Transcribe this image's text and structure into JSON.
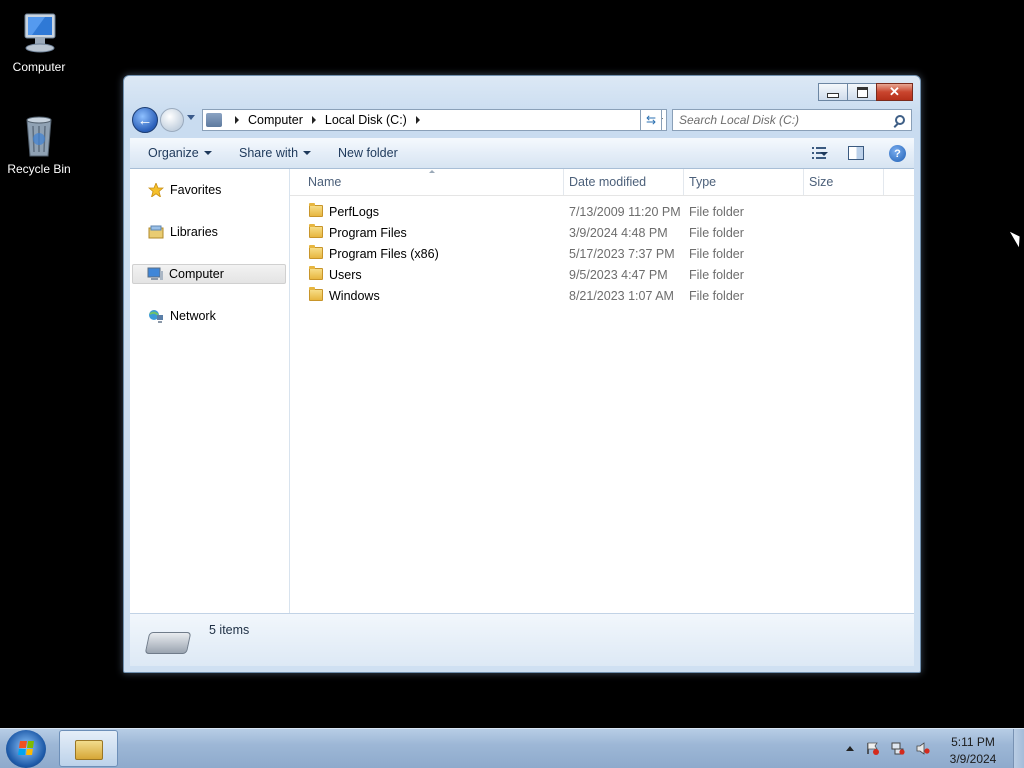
{
  "desktop": {
    "icons": [
      {
        "label": "Computer"
      },
      {
        "label": "Recycle Bin"
      }
    ]
  },
  "window": {
    "address": {
      "crumbs": [
        "Computer",
        "Local Disk (C:)"
      ]
    },
    "search": {
      "placeholder": "Search Local Disk (C:)"
    },
    "toolbar": {
      "organize": "Organize",
      "share_with": "Share with",
      "new_folder": "New folder"
    },
    "nav": {
      "items": [
        {
          "label": "Favorites",
          "selected": false
        },
        {
          "label": "Libraries",
          "selected": false
        },
        {
          "label": "Computer",
          "selected": true
        },
        {
          "label": "Network",
          "selected": false
        }
      ]
    },
    "columns": {
      "name": "Name",
      "date_modified": "Date modified",
      "type": "Type",
      "size": "Size"
    },
    "files": [
      {
        "name": "PerfLogs",
        "date": "7/13/2009 11:20 PM",
        "type": "File folder",
        "size": ""
      },
      {
        "name": "Program Files",
        "date": "3/9/2024 4:48 PM",
        "type": "File folder",
        "size": ""
      },
      {
        "name": "Program Files (x86)",
        "date": "5/17/2023 7:37 PM",
        "type": "File folder",
        "size": ""
      },
      {
        "name": "Users",
        "date": "9/5/2023 4:47 PM",
        "type": "File folder",
        "size": ""
      },
      {
        "name": "Windows",
        "date": "8/21/2023 1:07 AM",
        "type": "File folder",
        "size": ""
      }
    ],
    "details": {
      "item_count": "5 items"
    }
  },
  "taskbar": {
    "clock_time": "5:11 PM",
    "clock_date": "3/9/2024"
  }
}
